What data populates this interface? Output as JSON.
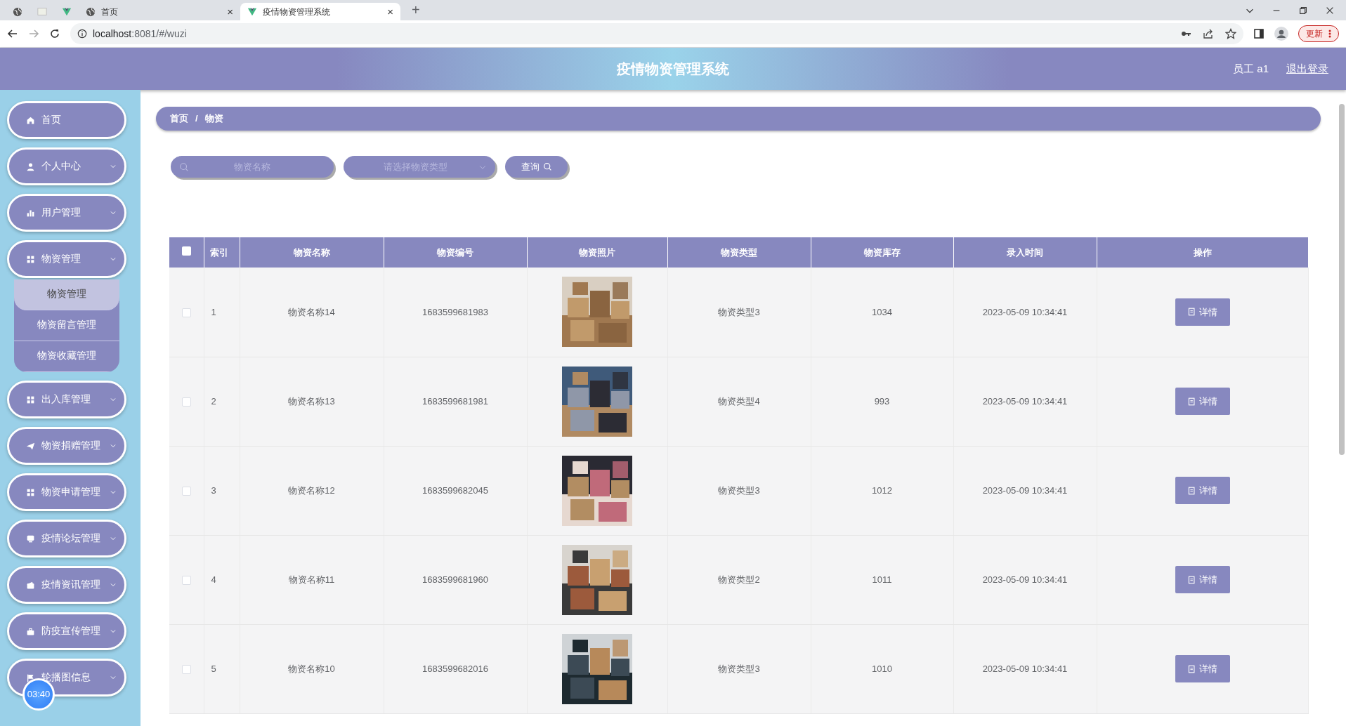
{
  "browser": {
    "tabs": [
      {
        "kind": "globe",
        "selected": false
      },
      {
        "kind": "page",
        "selected": false
      },
      {
        "kind": "vue",
        "selected": false
      },
      {
        "kind": "globe",
        "title": "首页",
        "close": "×",
        "selected": false
      },
      {
        "kind": "vue",
        "title": "疫情物资管理系统",
        "close": "×",
        "selected": true
      }
    ],
    "new_tab": "+",
    "url_host": "localhost",
    "url_rest": ":8081/#/wuzi",
    "update_button": "更新"
  },
  "header": {
    "title": "疫情物资管理系统",
    "user": "员工 a1",
    "logout": "退出登录"
  },
  "sidebar": {
    "items": [
      {
        "label": "首页",
        "kind": "link"
      },
      {
        "label": "个人中心",
        "kind": "menu"
      },
      {
        "label": "用户管理",
        "kind": "menu"
      },
      {
        "label": "物资管理",
        "kind": "menu",
        "children": [
          {
            "label": "物资管理",
            "selected": true
          },
          {
            "label": "物资留言管理",
            "selected": false
          },
          {
            "label": "物资收藏管理",
            "selected": false
          }
        ]
      },
      {
        "label": "出入库管理",
        "kind": "menu"
      },
      {
        "label": "物资捐赠管理",
        "kind": "menu"
      },
      {
        "label": "物资申请管理",
        "kind": "menu"
      },
      {
        "label": "疫情论坛管理",
        "kind": "menu"
      },
      {
        "label": "疫情资讯管理",
        "kind": "menu"
      },
      {
        "label": "防疫宣传管理",
        "kind": "menu"
      },
      {
        "label": "轮播图信息",
        "kind": "menu"
      }
    ]
  },
  "timer": "03:40",
  "breadcrumb": {
    "items": [
      "首页",
      "物资"
    ],
    "separator": "/"
  },
  "search": {
    "name_placeholder": "物资名称",
    "type_placeholder": "请选择物资类型",
    "query_button": "查询"
  },
  "table": {
    "all_checked": false,
    "columns": [
      "索引",
      "物资名称",
      "物资编号",
      "物资照片",
      "物资类型",
      "物资库存",
      "录入时间",
      "操作"
    ],
    "rows": [
      {
        "checked": false,
        "index": "1",
        "name": "物资名称14",
        "code": "1683599681983",
        "type": "物资类型3",
        "stock": "1034",
        "time": "2023-05-09 10:34:41",
        "action": "详情"
      },
      {
        "checked": false,
        "index": "2",
        "name": "物资名称13",
        "code": "1683599681981",
        "type": "物资类型4",
        "stock": "993",
        "time": "2023-05-09 10:34:41",
        "action": "详情"
      },
      {
        "checked": false,
        "index": "3",
        "name": "物资名称12",
        "code": "1683599682045",
        "type": "物资类型3",
        "stock": "1012",
        "time": "2023-05-09 10:34:41",
        "action": "详情"
      },
      {
        "checked": false,
        "index": "4",
        "name": "物资名称11",
        "code": "1683599681960",
        "type": "物资类型2",
        "stock": "1011",
        "time": "2023-05-09 10:34:41",
        "action": "详情"
      },
      {
        "checked": false,
        "index": "5",
        "name": "物资名称10",
        "code": "1683599682016",
        "type": "物资类型3",
        "stock": "1010",
        "time": "2023-05-09 10:34:41",
        "action": "详情"
      }
    ]
  }
}
